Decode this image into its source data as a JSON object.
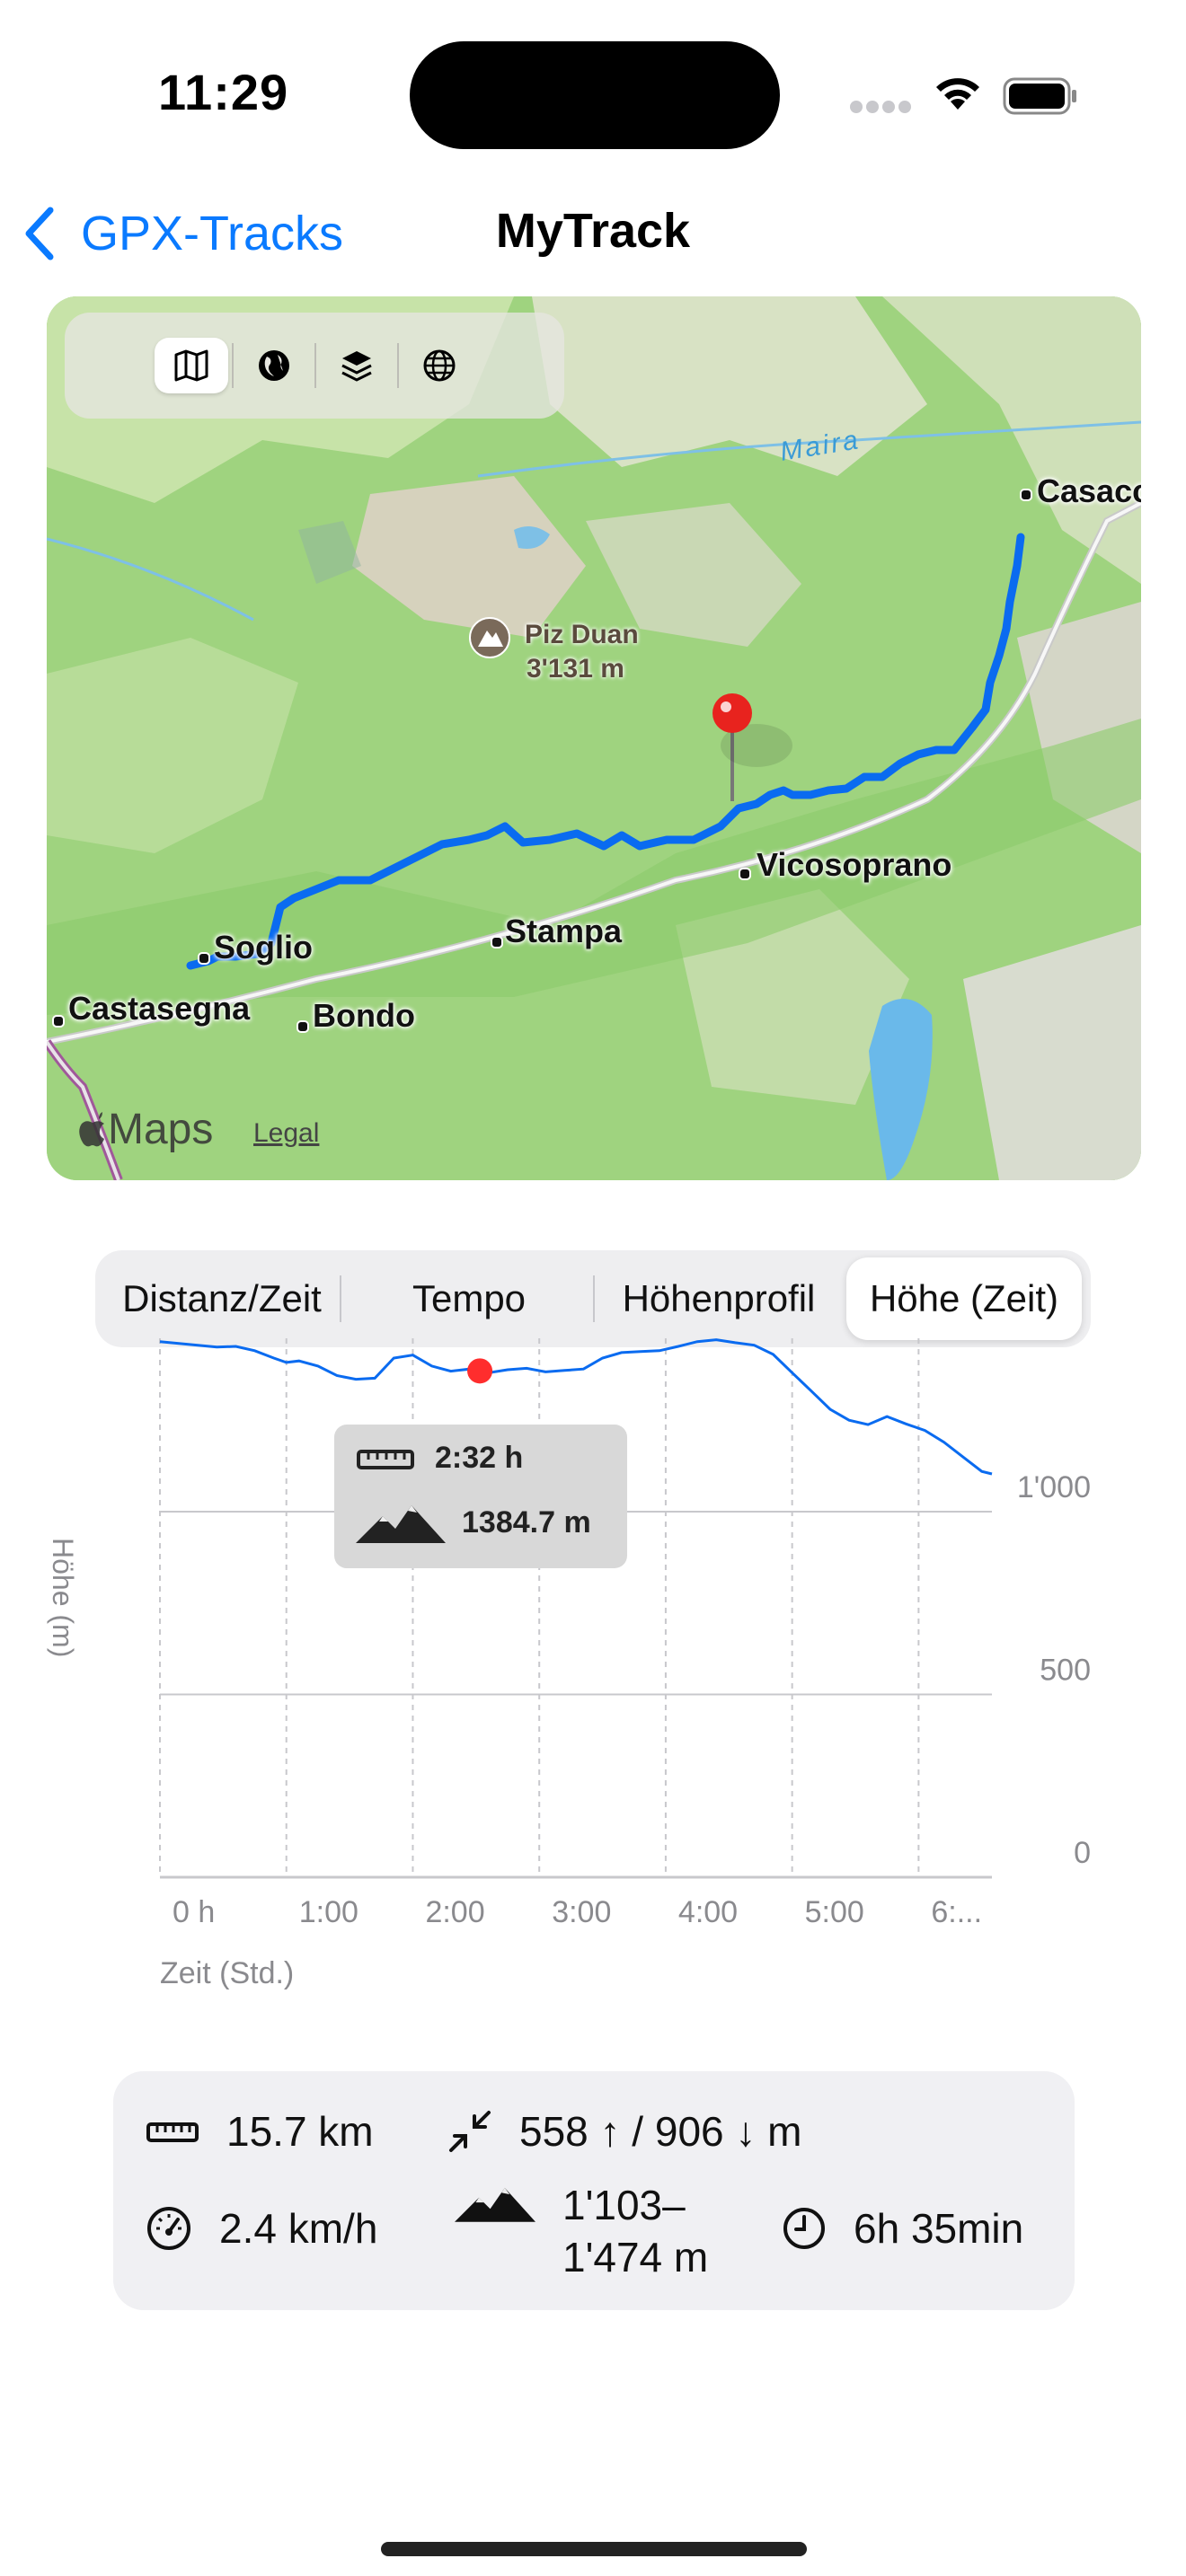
{
  "status_bar": {
    "time": "11:29"
  },
  "nav": {
    "back_label": "GPX-Tracks",
    "title": "MyTrack"
  },
  "map": {
    "places": {
      "casaccia": "Casacc",
      "piz_duan_name": "Piz Duan",
      "piz_duan_alt": "3'131 m",
      "vicosoprano": "Vicosoprano",
      "stampa": "Stampa",
      "soglio": "Soglio",
      "castasegna": "Castasegna",
      "bondo": "Bondo"
    },
    "river": "Maira",
    "brand": "Maps",
    "legal": "Legal",
    "controls": [
      "map-icon",
      "globe-icon",
      "layers-icon",
      "globe-grid-icon"
    ],
    "colors": {
      "track": "#0a6bf0",
      "pin": "#e8231e"
    }
  },
  "segmented": {
    "items": [
      "Distanz/Zeit",
      "Tempo",
      "Höhenprofil",
      "Höhe (Zeit)"
    ],
    "selected": "Höhe (Zeit)"
  },
  "chart_data": {
    "type": "line",
    "xlabel": "Zeit (Std.)",
    "ylabel": "Höhe (m)",
    "x_ticks": [
      "0 h",
      "1:00",
      "2:00",
      "3:00",
      "4:00",
      "5:00",
      "6:..."
    ],
    "y_ticks": [
      "1'000",
      "500",
      "0"
    ],
    "xlim": [
      0,
      6.58
    ],
    "ylim": [
      0,
      1474
    ],
    "series": [
      {
        "x": [
          0,
          0.15,
          0.3,
          0.45,
          0.6,
          0.75,
          0.9,
          1.0,
          1.1,
          1.25,
          1.4,
          1.55,
          1.7,
          1.85,
          2.0,
          2.15,
          2.3,
          2.45,
          2.53,
          2.6,
          2.75,
          2.9,
          3.05,
          3.2,
          3.35,
          3.5,
          3.65,
          3.8,
          3.95,
          4.1,
          4.25,
          4.4,
          4.55,
          4.7,
          4.85,
          5.0,
          5.15,
          5.3,
          5.45,
          5.6,
          5.75,
          5.9,
          6.05,
          6.2,
          6.35,
          6.5,
          6.58
        ],
        "y": [
          1465,
          1460,
          1455,
          1450,
          1452,
          1440,
          1420,
          1408,
          1412,
          1398,
          1372,
          1362,
          1365,
          1420,
          1428,
          1398,
          1384,
          1390,
          1384.7,
          1380,
          1388,
          1392,
          1382,
          1386,
          1390,
          1420,
          1435,
          1438,
          1440,
          1452,
          1465,
          1470,
          1462,
          1455,
          1430,
          1380,
          1330,
          1280,
          1250,
          1238,
          1260,
          1240,
          1222,
          1190,
          1150,
          1110,
          1103
        ]
      }
    ],
    "marker": {
      "x": 2.53,
      "y": 1384.7,
      "color": "#ff2d2d"
    },
    "tooltip": {
      "time": "2:32 h",
      "elevation": "1384.7 m"
    },
    "line_color": "#0a6bf0",
    "grid": true
  },
  "stats": {
    "distance": "15.7 km",
    "elevation_change": "558 ↑ / 906 ↓ m",
    "speed": "2.4 km/h",
    "elevation_range_line1": "1'103–",
    "elevation_range_line2": "1'474 m",
    "duration": "6h 35min"
  }
}
